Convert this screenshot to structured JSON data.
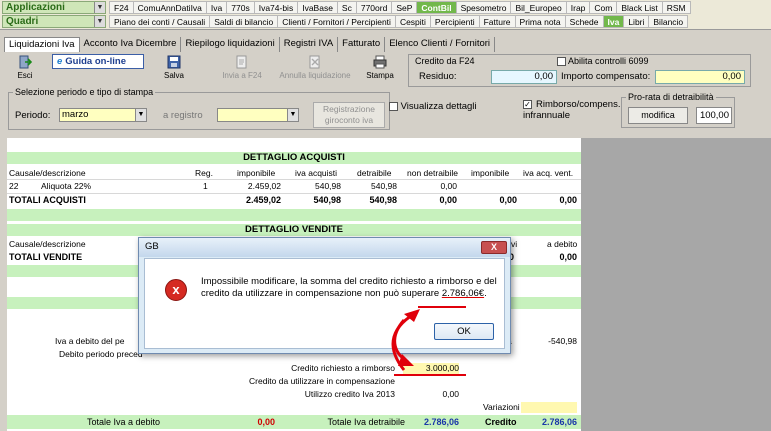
{
  "topbar": {
    "combo_app": "Applicazioni",
    "combo_quadri": "Quadri",
    "menu1": [
      "F24",
      "ComuAnnDatiIva",
      "Iva",
      "770s",
      "Iva74-bis",
      "IvaBase",
      "Sc",
      "770ord",
      "SeP",
      "ContBil",
      "Spesometro",
      "Bil_Europeo",
      "Irap",
      "Com",
      "Black List",
      "RSM"
    ],
    "menu1_active": "ContBil",
    "menu2": [
      "Piano dei conti / Causali",
      "Saldi di bilancio",
      "Clienti / Fornitori / Percipienti",
      "Cespiti",
      "Percipienti",
      "Fatture",
      "Prima nota",
      "Schede",
      "Iva",
      "Libri",
      "Bilancio"
    ],
    "menu2_active": "Iva"
  },
  "tabs": [
    "Liquidazioni Iva",
    "Acconto Iva Dicembre",
    "Riepilogo liquidazioni",
    "Registri IVA",
    "Fatturato",
    "Elenco Clienti / Fornitori"
  ],
  "toolbar": {
    "esci": "Esci",
    "guida_prefix": "e",
    "guida": "Guida on-line",
    "salva": "Salva",
    "invia_f24": "Invia a F24",
    "annulla": "Annulla liquidazione",
    "stampa": "Stampa",
    "credito_title": "Credito da F24",
    "abilita_controlli": "Abilita controlli 6099",
    "residuo_label": "Residuo:",
    "residuo_value": "0,00",
    "importo_label": "Importo compensato:",
    "importo_value": "0,00"
  },
  "selezione": {
    "title": "Selezione periodo e tipo di stampa",
    "periodo_label": "Periodo:",
    "periodo_value": "marzo",
    "registro_label": "a registro",
    "registrazione_btn": "Registrazione giroconto iva",
    "visualizza": "Visualizza dettagli",
    "rimborso": "Rimborso/compens. infrannuale",
    "prorata_title": "Pro-rata di detraibilità",
    "modifica": "modifica",
    "prorata_value": "100,00"
  },
  "acquisti": {
    "title": "DETTAGLIO ACQUISTI",
    "headers": [
      "Causale/descrizione",
      "Reg.",
      "imponibile",
      "iva acquisti",
      "detraibile",
      "non detraibile",
      "imponibile",
      "iva acq. vent."
    ],
    "row": [
      "22",
      "Aliquota 22%",
      "1",
      "2.459,02",
      "540,98",
      "540,98",
      "0,00"
    ],
    "totali_label": "TOTALI ACQUISTI",
    "totali": [
      "2.459,02",
      "540,98",
      "540,98",
      "0,00",
      "0,00",
      "0,00"
    ]
  },
  "vendite": {
    "title": "DETTAGLIO VENDITE",
    "header_left": "Causale/descrizione",
    "header_right_1": "vi",
    "header_right_2": "a debito",
    "totali_label": "TOTALI VENDITE",
    "totali_right": [
      "0",
      "0,00"
    ]
  },
  "riepilogo": {
    "iva_debito": "Iva a debito del pe",
    "debito_prec": "Debito periodo preced",
    "iva_debito_tail": "a",
    "iva_debito_value": "-540,98",
    "credito_richiesto_label": "Credito richiesto a rimborso",
    "credito_richiesto_value": "3.000,00",
    "credito_compensazione": "Credito da utilizzare in compensazione",
    "utilizzo_credito": "Utilizzo credito Iva 2013",
    "utilizzo_value": "0,00",
    "variazioni": "Variazioni",
    "totale_debito_label": "Totale Iva a debito",
    "totale_debito_value": "0,00",
    "totale_detraibile_label": "Totale Iva detraibile",
    "totale_detraibile_value": "2.786,06",
    "credito_label": "Credito",
    "credito_value": "2.786,06"
  },
  "dialog": {
    "title": "GB",
    "close": "X",
    "icon": "x",
    "message_1": "Impossibile modificare, la somma del credito richiesto a rimborso e del credito da utilizzare in compensazione non può superare",
    "message_amount": "2.786,06€",
    "message_end": ".",
    "ok": "OK"
  },
  "colors": {
    "menu_active": "#72b84b",
    "band_green": "#c7f1bd",
    "dialog_bg": "#dcebf6",
    "error_red": "#d52a22",
    "annotation_red": "#e0000b"
  }
}
